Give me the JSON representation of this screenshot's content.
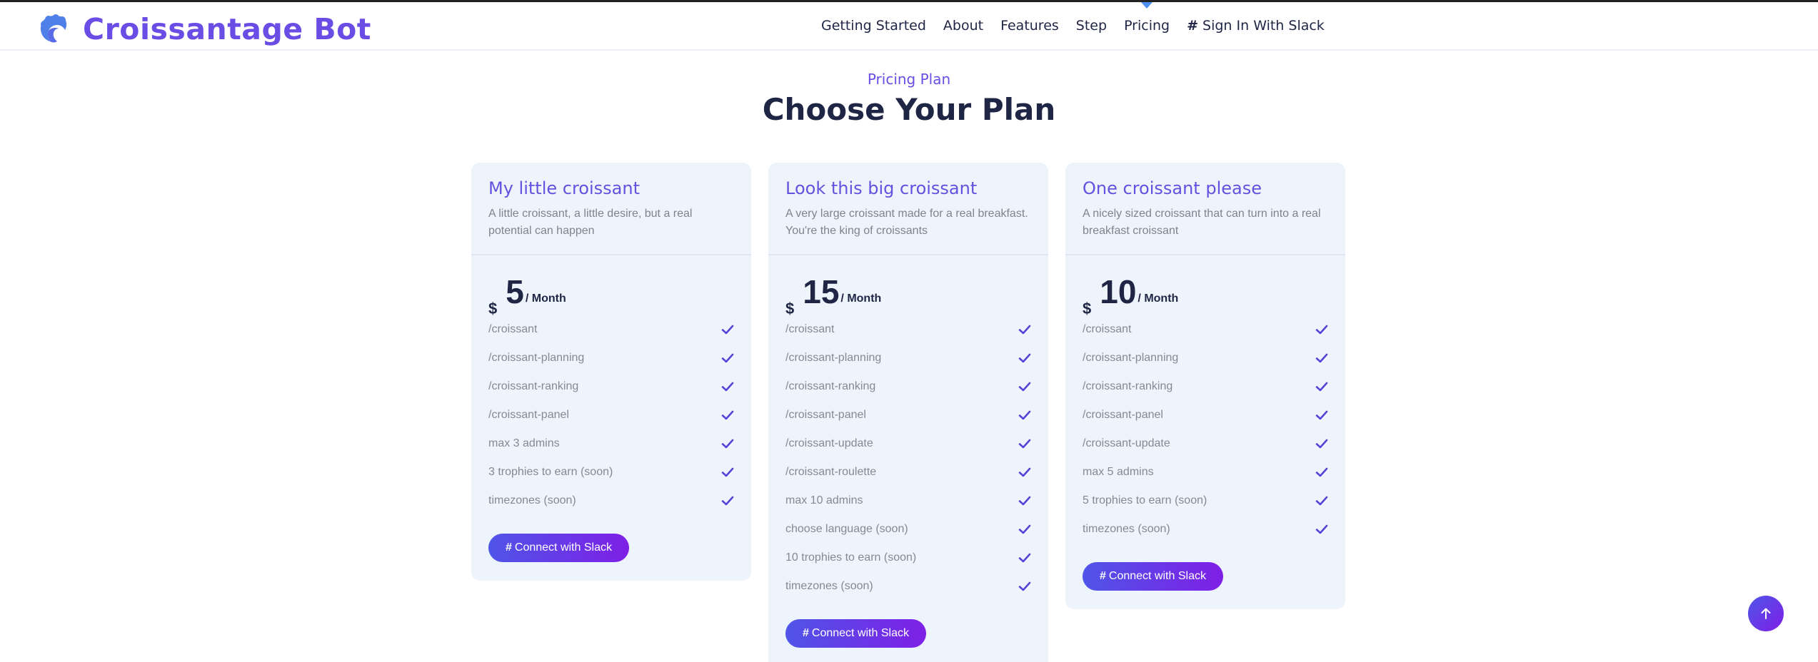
{
  "header": {
    "brand": "Croissantage Bot",
    "nav": [
      {
        "label": "Getting Started"
      },
      {
        "label": "About"
      },
      {
        "label": "Features"
      },
      {
        "label": "Step"
      },
      {
        "label": "Pricing"
      },
      {
        "label": "Sign In With Slack",
        "icon": "slack-icon"
      }
    ],
    "active_nav": "Pricing"
  },
  "section": {
    "pre_title": "Pricing Plan",
    "title": "Choose Your Plan"
  },
  "colors": {
    "brand": "#6a4de4",
    "card_bg": "#eef4fc",
    "check": "#5a42d6",
    "button_from": "#4f55e8",
    "button_to": "#7f1fe6"
  },
  "plans": [
    {
      "title": "My little croissant",
      "description": "A little croissant, a little desire, but a real potential can happen",
      "currency": "$",
      "price": "5",
      "period": "/ Month",
      "features": [
        "/croissant",
        "/croissant-planning",
        "/croissant-ranking",
        "/croissant-panel",
        "max 3 admins",
        "3 trophies to earn (soon)",
        "timezones (soon)"
      ],
      "button": "Connect with Slack"
    },
    {
      "title": "Look this big croissant",
      "description": "A very large croissant made for a real breakfast. You're the king of croissants",
      "currency": "$",
      "price": "15",
      "period": "/ Month",
      "features": [
        "/croissant",
        "/croissant-planning",
        "/croissant-ranking",
        "/croissant-panel",
        "/croissant-update",
        "/croissant-roulette",
        "max 10 admins",
        "choose language (soon)",
        "10 trophies to earn (soon)",
        "timezones (soon)"
      ],
      "button": "Connect with Slack"
    },
    {
      "title": "One croissant please",
      "description": "A nicely sized croissant that can turn into a real breakfast croissant",
      "currency": "$",
      "price": "10",
      "period": "/ Month",
      "features": [
        "/croissant",
        "/croissant-planning",
        "/croissant-ranking",
        "/croissant-panel",
        "/croissant-update",
        "max 5 admins",
        "5 trophies to earn (soon)",
        "timezones (soon)"
      ],
      "button": "Connect with Slack"
    }
  ]
}
